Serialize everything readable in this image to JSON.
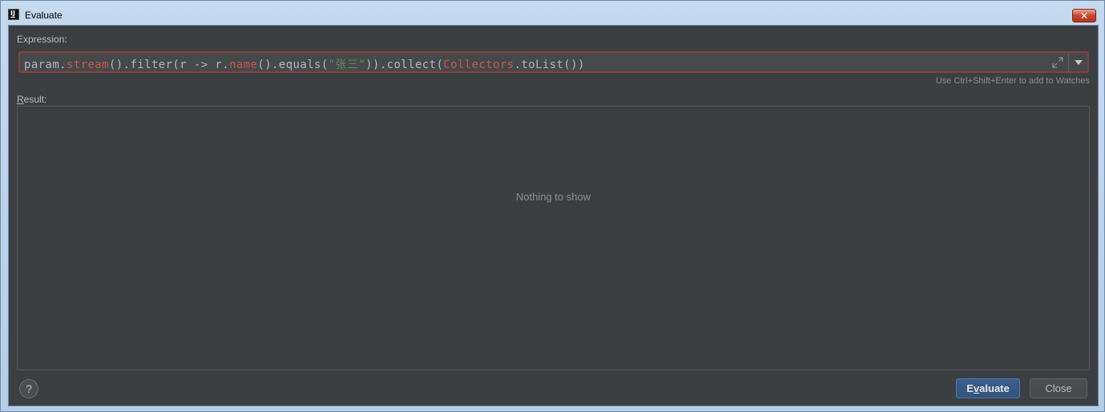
{
  "window": {
    "title": "Evaluate",
    "app_icon_text": "IJ",
    "close_glyph": "✕"
  },
  "expression": {
    "label": "Expression:",
    "tokens": [
      {
        "text": "param.",
        "color": "default"
      },
      {
        "text": "stream",
        "color": "red"
      },
      {
        "text": "().filter(r -> r.",
        "color": "default"
      },
      {
        "text": "name",
        "color": "red"
      },
      {
        "text": "().equals(",
        "color": "default"
      },
      {
        "text": "\"张三\"",
        "color": "green"
      },
      {
        "text": ")).collect(",
        "color": "default"
      },
      {
        "text": "Collectors",
        "color": "red"
      },
      {
        "text": ".toList())",
        "color": "default"
      }
    ],
    "hint": "Use Ctrl+Shift+Enter to add to Watches",
    "expand_icon": "expand-icon",
    "dropdown_icon": "chevron-down-icon"
  },
  "result": {
    "label_first": "R",
    "label_rest": "esult:",
    "empty_text": "Nothing to show"
  },
  "footer": {
    "help_label": "?",
    "evaluate_first": "E",
    "evaluate_underlined": "v",
    "evaluate_rest": "aluate",
    "close_label": "Close"
  },
  "colors": {
    "background": "#3c3f41",
    "code_default": "#a9b7c6",
    "code_red": "#c75450",
    "code_green": "#6a8759",
    "accent_button": "#365880",
    "error_border": "#8b3c3c"
  }
}
